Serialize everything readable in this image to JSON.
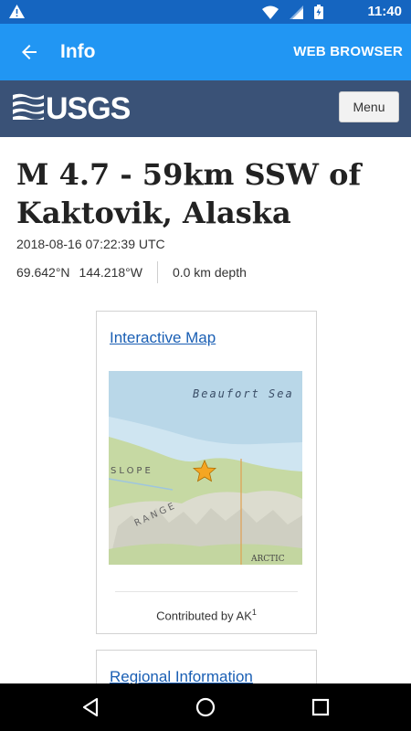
{
  "status_bar": {
    "time": "11:40"
  },
  "app_bar": {
    "title": "Info",
    "web_browser_label": "WEB BROWSER"
  },
  "usgs_header": {
    "logo_text": "USGS",
    "menu_label": "Menu"
  },
  "event": {
    "title": "M 4.7 - 59km SSW of Kaktovik, Alaska",
    "time": "2018-08-16 07:22:39 UTC",
    "latitude": "69.642°N",
    "longitude": "144.218°W",
    "depth": "0.0 km depth"
  },
  "map_card": {
    "link_label": "Interactive Map",
    "sea_label": "Beaufort Sea",
    "slope_label": "SLOPE",
    "range_label": "RANGE",
    "refuge_label": "ARCTIC",
    "contributed_by": "Contributed by AK",
    "footnote": "1"
  },
  "regional_card": {
    "link_label": "Regional Information"
  },
  "colors": {
    "status_bar": "#1565c0",
    "app_bar": "#2196f3",
    "usgs_header": "#3a5277",
    "link": "#1a5fb4"
  }
}
